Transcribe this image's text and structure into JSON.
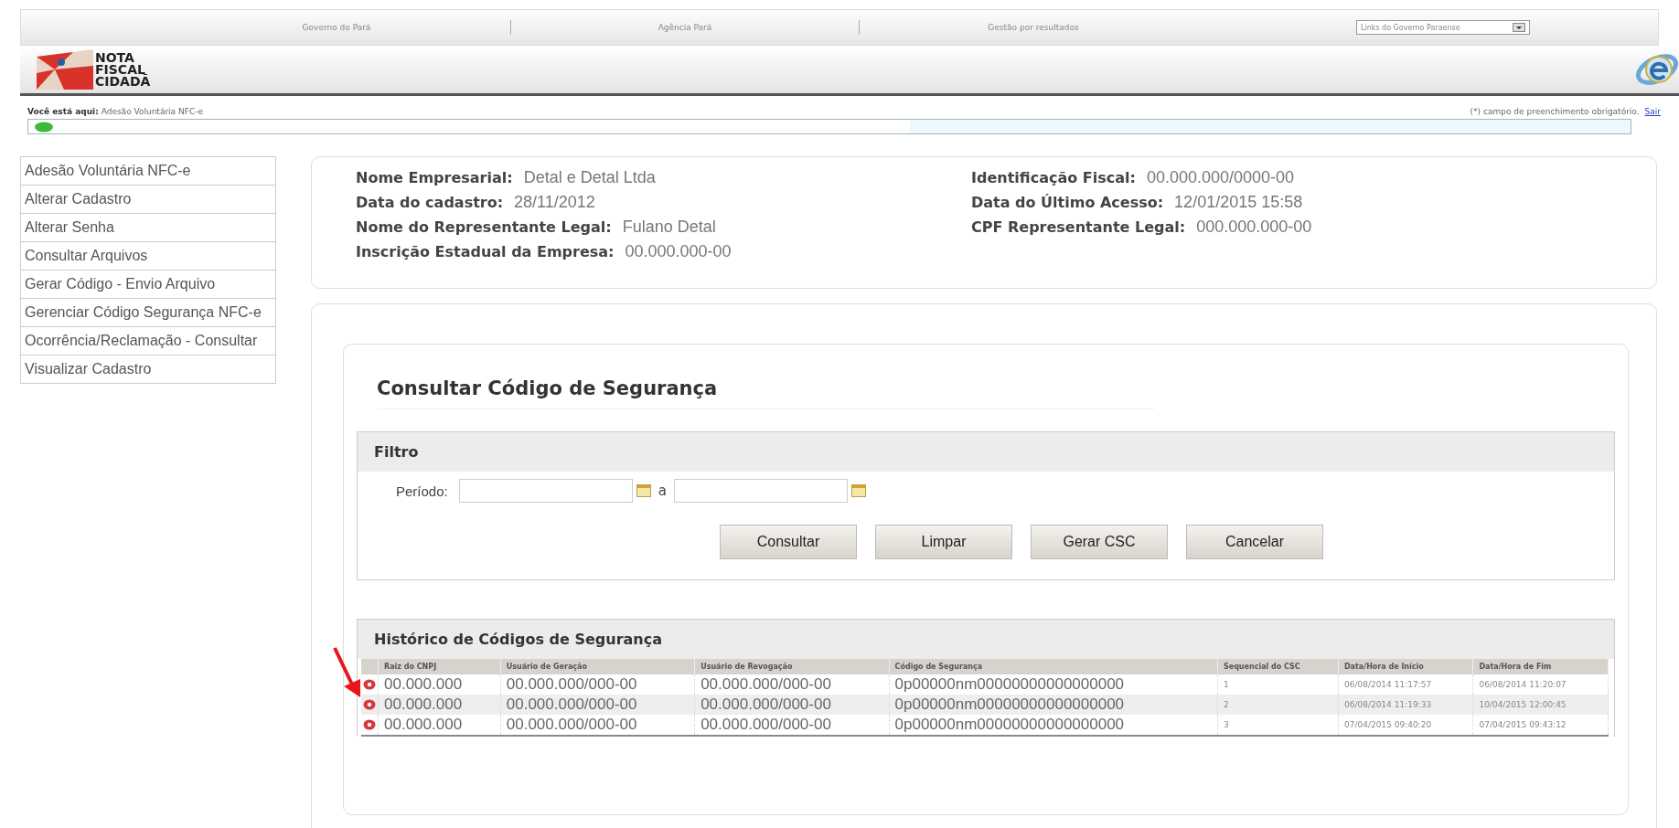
{
  "top_nav": {
    "links": [
      "Governo do Pará",
      "Agência Pará",
      "Gestão por resultados"
    ],
    "dropdown": "Links do Governo Paraense"
  },
  "logo": {
    "lines": [
      "NOTA",
      "FISCAL",
      "CIDADÃ"
    ]
  },
  "breadcrumb": {
    "label": "Você está aqui:",
    "page": "Adesão Voluntária NFC-e",
    "note": "(*) campo de preenchimento obrigatório.",
    "exit_link": "Sair"
  },
  "sidebar": {
    "items": [
      {
        "label": "Adesão Voluntária NFC-e"
      },
      {
        "label": "Alterar Cadastro"
      },
      {
        "label": "Alterar Senha"
      },
      {
        "label": "Consultar Arquivos"
      },
      {
        "label": "Gerar Código - Envio Arquivo"
      },
      {
        "label": "Gerenciar Código Segurança NFC-e"
      },
      {
        "label": "Ocorrência/Reclamação - Consultar"
      },
      {
        "label": "Visualizar Cadastro"
      }
    ]
  },
  "company": {
    "left": [
      {
        "label": "Nome Empresarial:",
        "value": "Detal e Detal Ltda"
      },
      {
        "label": "Data do cadastro:",
        "value": "28/11/2012"
      },
      {
        "label": "Nome do Representante Legal:",
        "value": "Fulano Detal"
      },
      {
        "label": "Inscrição Estadual da Empresa:",
        "value": "00.000.000-00"
      }
    ],
    "right": [
      {
        "label": "Identificação Fiscal:",
        "value": "00.000.000/0000-00"
      },
      {
        "label": "Data do Último Acesso:",
        "value": "12/01/2015 15:58"
      },
      {
        "label": "CPF Representante Legal:",
        "value": "000.000.000-00"
      }
    ]
  },
  "page_title": "Consultar Código de Segurança",
  "filter": {
    "title": "Filtro",
    "period_label": "Período:",
    "between": "a",
    "buttons": [
      "Consultar",
      "Limpar",
      "Gerar CSC",
      "Cancelar"
    ]
  },
  "history": {
    "title": "Histórico de Códigos de Segurança",
    "columns": [
      "Raiz do CNPJ",
      "Usuário de Geração",
      "Usuário de Revogação",
      "Código de Segurança",
      "Sequencial do CSC",
      "Data/Hora de Início",
      "Data/Hora de Fim"
    ],
    "rows": [
      [
        "00.000.000",
        "00.000.000/000-00",
        "00.000.000/000-00",
        "0p00000nm00000000000000000",
        "1",
        "06/08/2014 11:17:57",
        "06/08/2014 11:20:07"
      ],
      [
        "00.000.000",
        "00.000.000/000-00",
        "00.000.000/000-00",
        "0p00000nm00000000000000000",
        "2",
        "06/08/2014 11:19:33",
        "10/04/2015 12:00:45"
      ],
      [
        "00.000.000",
        "00.000.000/000-00",
        "00.000.000/000-00",
        "0p00000nm00000000000000000",
        "3",
        "07/04/2015 09:40:20",
        "07/04/2015 09:43:12"
      ]
    ]
  }
}
